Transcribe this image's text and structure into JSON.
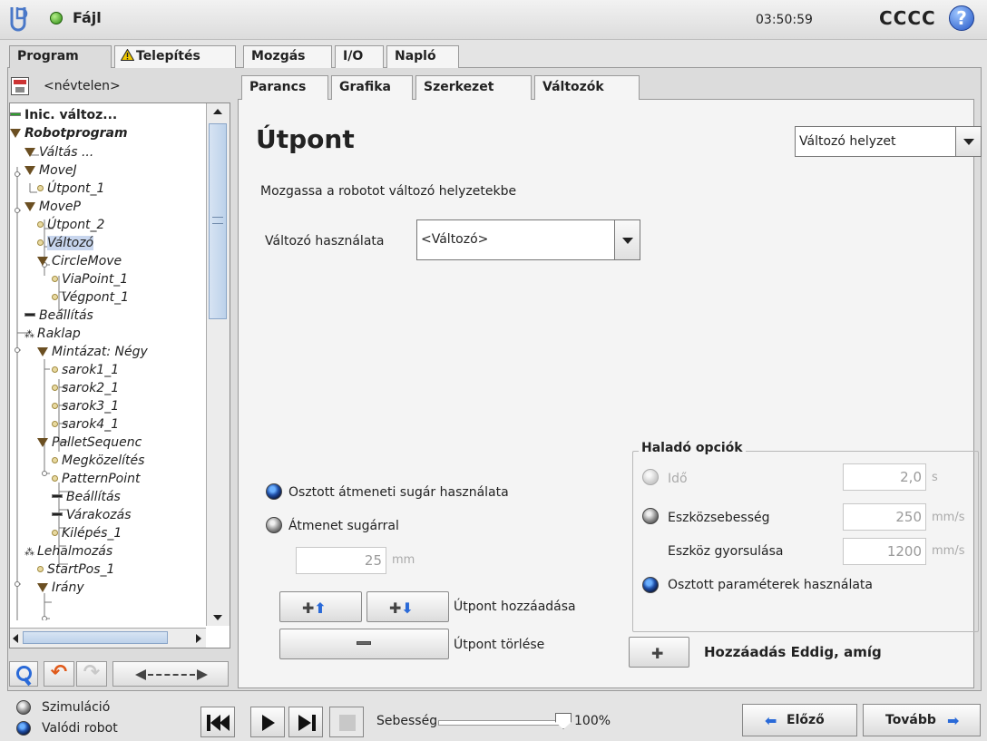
{
  "header": {
    "menu_label": "Fájl",
    "clock": "03:50:59",
    "robot_name": "CCCC",
    "help_symbol": "?"
  },
  "main_tabs": [
    "Program",
    "Telepítés",
    "Mozgás",
    "I/O",
    "Napló"
  ],
  "program": {
    "name": "<névtelen>"
  },
  "sub_tabs": [
    "Parancs",
    "Grafika",
    "Szerkezet",
    "Változók"
  ],
  "tree": [
    {
      "label": "Inic. változ...",
      "icon": "dash-green",
      "style": "bold"
    },
    {
      "label": "Robotprogram",
      "icon": "triangle",
      "style": "bold-italic"
    },
    {
      "label": "Váltás ...",
      "icon": "triangle",
      "style": "italic"
    },
    {
      "label": "MoveJ",
      "icon": "triangle",
      "style": "italic"
    },
    {
      "label": "Útpont_1",
      "icon": "dot",
      "style": "italic"
    },
    {
      "label": "MoveP",
      "icon": "triangle",
      "style": "italic"
    },
    {
      "label": "Útpont_2",
      "icon": "dot",
      "style": "italic"
    },
    {
      "label": "Változó",
      "icon": "dot",
      "style": "italic",
      "selected": true
    },
    {
      "label": "CircleMove",
      "icon": "triangle",
      "style": "italic"
    },
    {
      "label": "ViaPoint_1",
      "icon": "dot",
      "style": "italic"
    },
    {
      "label": "Végpont_1",
      "icon": "dot",
      "style": "italic"
    },
    {
      "label": "Beállítás",
      "icon": "dash",
      "style": "italic"
    },
    {
      "label": "Raklap",
      "icon": "pallet",
      "style": "italic"
    },
    {
      "label": "Mintázat: Négy",
      "icon": "triangle",
      "style": "italic"
    },
    {
      "label": "sarok1_1",
      "icon": "dot",
      "style": "italic"
    },
    {
      "label": "sarok2_1",
      "icon": "dot",
      "style": "italic"
    },
    {
      "label": "sarok3_1",
      "icon": "dot",
      "style": "italic"
    },
    {
      "label": "sarok4_1",
      "icon": "dot",
      "style": "italic"
    },
    {
      "label": "PalletSequenc",
      "icon": "triangle",
      "style": "italic"
    },
    {
      "label": "Megközelítés",
      "icon": "dot",
      "style": "italic"
    },
    {
      "label": "PatternPoint",
      "icon": "dot",
      "style": "italic"
    },
    {
      "label": "Beállítás",
      "icon": "dash",
      "style": "italic"
    },
    {
      "label": "Várakozás",
      "icon": "dash",
      "style": "italic"
    },
    {
      "label": "Kilépés_1",
      "icon": "dot",
      "style": "italic"
    },
    {
      "label": "Lehalmozás",
      "icon": "pallet",
      "style": "italic"
    },
    {
      "label": "StartPos_1",
      "icon": "dot",
      "style": "italic"
    },
    {
      "label": "Irány",
      "icon": "triangle",
      "style": "italic"
    }
  ],
  "command": {
    "title": "Útpont",
    "type_select": "Változó helyzet",
    "description": "Mozgassa a robotot változó helyzetekbe",
    "var_label": "Változó használata",
    "var_select": "<Változó>"
  },
  "blend": {
    "shared_label": "Osztott átmeneti sugár használata",
    "radius_label": "Átmenet sugárral",
    "radius_value": "25",
    "radius_unit": "mm",
    "selected": "shared"
  },
  "waypoint_actions": {
    "add_label": "Útpont hozzáadása",
    "remove_label": "Útpont törlése"
  },
  "advanced": {
    "title": "Haladó opciók",
    "time_label": "Idő",
    "time_value": "2,0",
    "time_unit": "s",
    "speed_label": "Eszközsebesség",
    "speed_value": "250",
    "speed_unit": "mm/s",
    "accel_label": "Eszköz gyorsulása",
    "accel_value": "1200",
    "accel_unit": "mm/s",
    "shared_label": "Osztott paraméterek használata",
    "selected": "shared"
  },
  "add_until": {
    "label": "Hozzáadás Eddig, amíg"
  },
  "footer": {
    "mode_sim": "Szimuláció",
    "mode_real": "Valódi robot",
    "mode_selected": "real",
    "speed_label": "Sebesség",
    "speed_value": "100%",
    "speed_fraction": 1.0,
    "prev_label": "Előző",
    "next_label": "Tovább"
  },
  "colors": {
    "accent_blue": "#2a6ad8",
    "status_green": "#2a8a10",
    "warning_yellow": "#f0c800",
    "selection": "#c8d6ee"
  }
}
